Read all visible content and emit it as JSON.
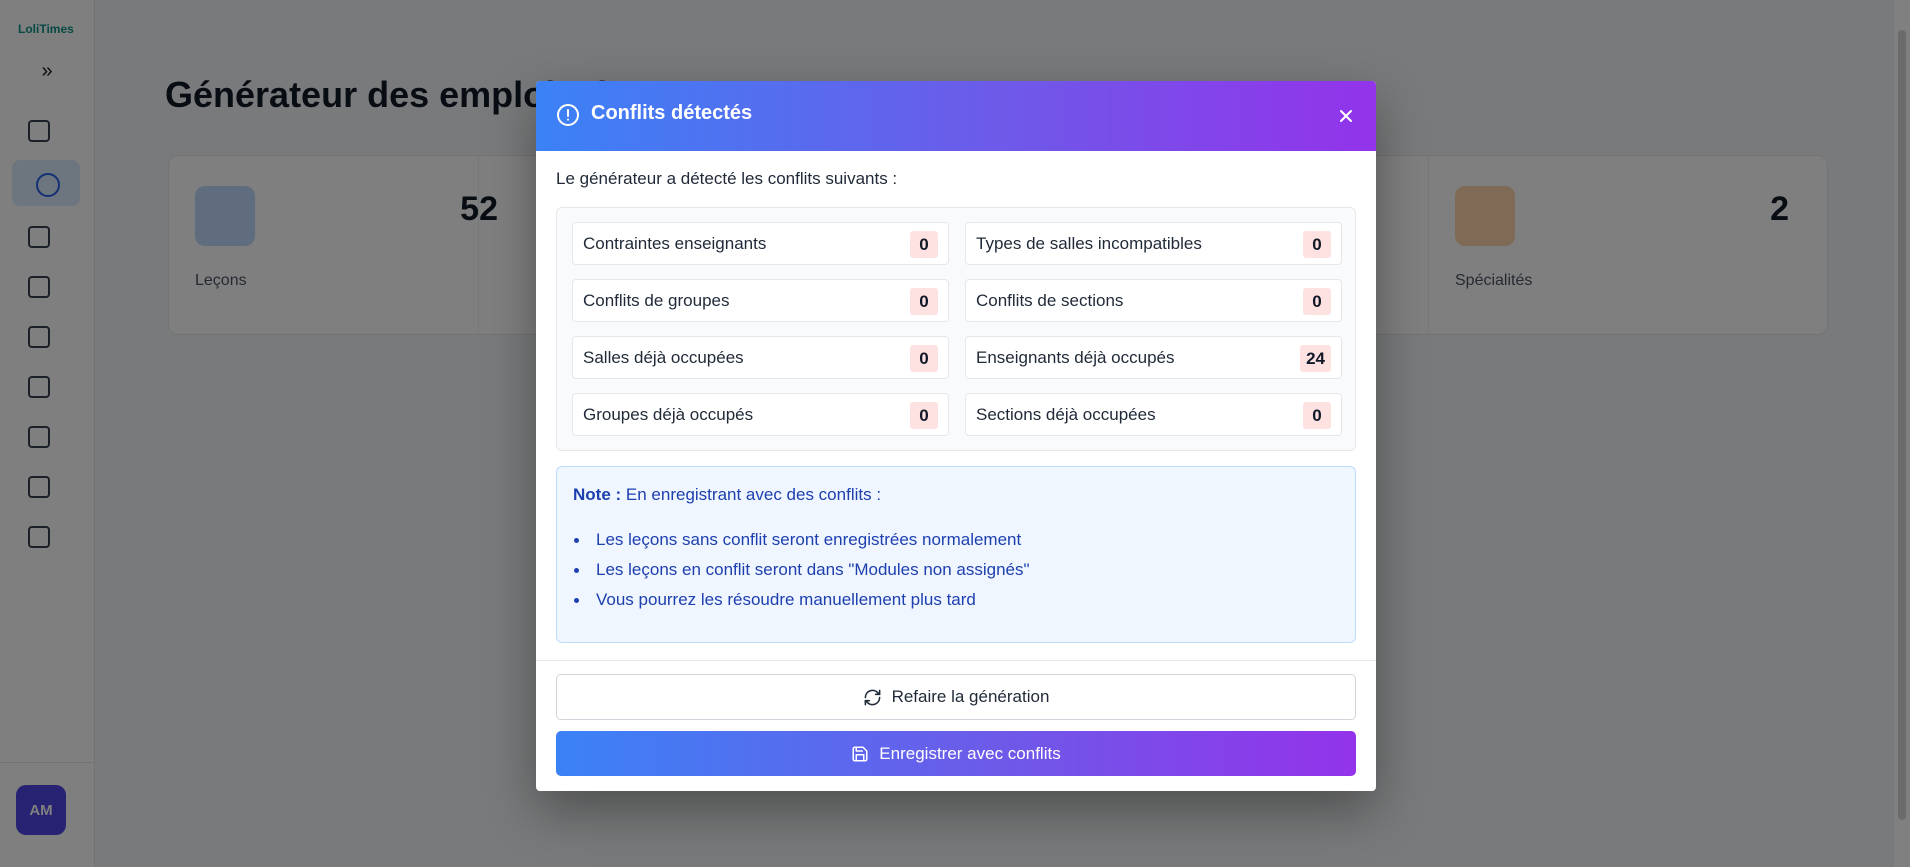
{
  "app": {
    "brand": "LoliTimes",
    "avatar_initials": "AM",
    "page_title": "Générateur des emplois du temps"
  },
  "stats": [
    {
      "label": "Leçons",
      "value": "52",
      "color": "#bfdbfe"
    },
    {
      "label": "",
      "value": "",
      "color": "#e5e7eb"
    },
    {
      "label": "",
      "value": "",
      "color": "#e5e7eb"
    },
    {
      "label": "",
      "value": "",
      "color": "#e5e7eb"
    },
    {
      "label": "Spécialités",
      "value": "2",
      "color": "#fed7aa"
    }
  ],
  "modal": {
    "title": "Conflits détectés",
    "header_icon": "alert-circle-icon",
    "close_icon": "close-icon",
    "intro": "Le générateur a détecté les conflits suivants :",
    "conflicts": [
      {
        "label": "Contraintes enseignants",
        "count": "0"
      },
      {
        "label": "Types de salles incompatibles",
        "count": "0"
      },
      {
        "label": "Conflits de groupes",
        "count": "0"
      },
      {
        "label": "Conflits de sections",
        "count": "0"
      },
      {
        "label": "Salles déjà occupées",
        "count": "0"
      },
      {
        "label": "Enseignants déjà occupés",
        "count": "24"
      },
      {
        "label": "Groupes déjà occupés",
        "count": "0"
      },
      {
        "label": "Sections déjà occupées",
        "count": "0"
      }
    ],
    "note": {
      "label": "Note :",
      "text": "En enregistrant avec des conflits :",
      "items": [
        "Les leçons sans conflit seront enregistrées normalement",
        "Les leçons en conflit seront dans \"Modules non assignés\"",
        "Vous pourrez les résoudre manuellement plus tard"
      ]
    },
    "regenerate_label": "Refaire la génération",
    "regenerate_icon": "refresh-icon",
    "save_label": "Enregistrer avec conflits",
    "save_icon": "save-icon"
  },
  "colors": {
    "gradient_start": "#3b82f6",
    "gradient_end": "#9333ea",
    "note_text": "#1e40af",
    "count_badge": "#fee2e2"
  }
}
